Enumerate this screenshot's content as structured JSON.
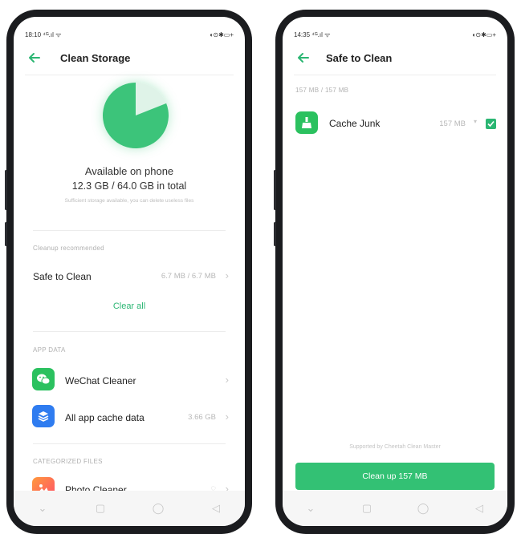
{
  "colors": {
    "accent": "#2bb673",
    "pie": "#3cc47a",
    "primary_button": "#33c174"
  },
  "left": {
    "status": {
      "time": "18:10",
      "signal": "⁴ᴳ.ıl ᯤ",
      "battery": "◖⊙✱▭+"
    },
    "title": "Clean Storage",
    "storage": {
      "used_fraction": 0.81,
      "heading": "Available on phone",
      "amount": "12.3 GB / 64.0 GB in total",
      "note": "Sufficient storage available, you can delete useless files"
    },
    "cleanup": {
      "section": "Cleanup recommended",
      "safe_label": "Safe to Clean",
      "safe_value": "6.7 MB / 6.7 MB",
      "clear_all": "Clear all"
    },
    "app_data": {
      "section": "APP DATA",
      "items": [
        {
          "label": "WeChat Cleaner",
          "value": "",
          "icon": "wechat-icon",
          "color": "#2bc15f"
        },
        {
          "label": "All app cache data",
          "value": "3.66 GB",
          "icon": "layers-icon",
          "color": "#2f7cf0"
        }
      ]
    },
    "categorized": {
      "section": "CATEGORIZED FILES",
      "items": [
        {
          "label": "Photo Cleaner",
          "icon": "photo-icon"
        }
      ]
    },
    "nav": {
      "menu": "⌄",
      "home": "◯",
      "back": "◁",
      "recents": "▢"
    }
  },
  "right": {
    "status": {
      "time": "14:35",
      "signal": "⁴ᴳ.ıl ᯤ",
      "battery": "◖⊙✱▭+"
    },
    "title": "Safe to Clean",
    "summary": "157 MB / 157 MB",
    "items": [
      {
        "label": "Cache Junk",
        "size": "157 MB",
        "checked": true
      }
    ],
    "footer_note": "Supported by Cheetah Clean Master",
    "button": "Clean up 157 MB",
    "nav": {
      "menu": "⌄",
      "home": "◯",
      "back": "◁",
      "recents": "▢"
    }
  }
}
